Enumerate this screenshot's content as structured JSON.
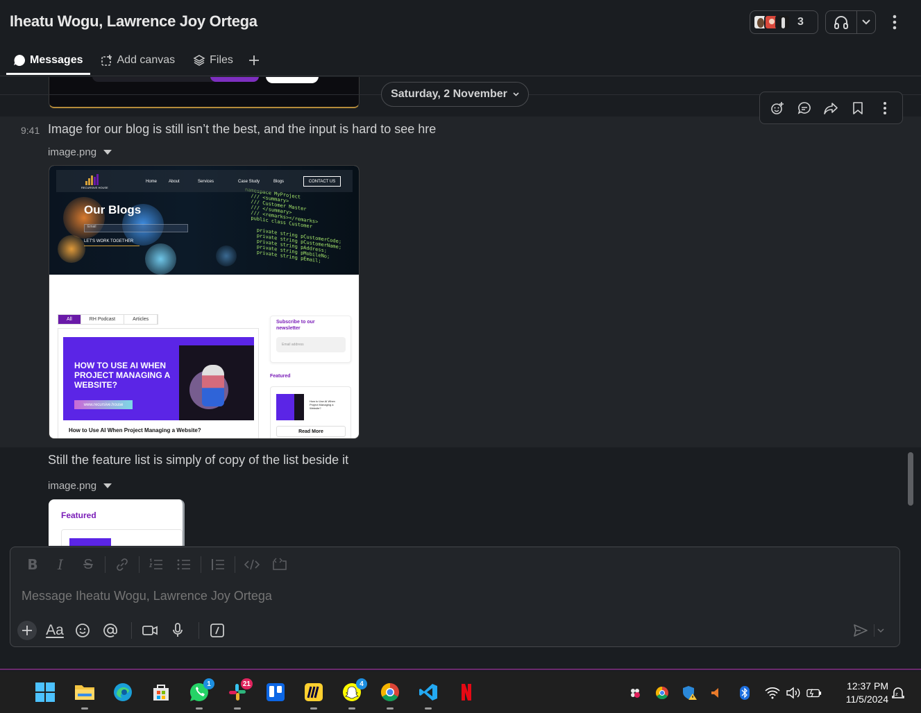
{
  "header": {
    "title": "Iheatu Wogu, Lawrence Joy Ortega",
    "member_count": "3",
    "avatars": [
      "avatar-1",
      "avatar-2",
      "avatar-3"
    ]
  },
  "tabs": [
    {
      "label": "Messages",
      "icon": "message-bubble-icon",
      "active": true
    },
    {
      "label": "Add canvas",
      "icon": "canvas-icon"
    },
    {
      "label": "Files",
      "icon": "layers-icon"
    }
  ],
  "date_divider": "Saturday, 2 November",
  "messages": [
    {
      "time": "9:41",
      "text": "Image for our blog is still isn’t the best, and the input is hard to see hre",
      "attachment": "image.png"
    },
    {
      "text": "Still the feature list is simply of copy of the list beside it",
      "attachment": "image.png"
    }
  ],
  "shot1": {
    "nav_items": [
      "Home",
      "About",
      "Services",
      "Case Study",
      "Blogs"
    ],
    "contact": "CONTACT US",
    "logo_text": "RECURSIVE HOUSE",
    "hero_title": "Our Blogs",
    "hero_input": "Email",
    "hero_cta": "LET'S WORK TOGETHER",
    "tabs": [
      "All",
      "RH Podcast",
      "Articles"
    ],
    "banner_title": "HOW TO USE AI WHEN PROJECT MANAGING A WEBSITE?",
    "banner_url": "www.recursive.house",
    "card_title": "How to Use AI When Project Managing a Website?",
    "subscribe": "Subscribe to our newsletter",
    "email_placeholder": "Email address",
    "featured": "Featured",
    "featured_text": "How to Use AI When Project Managing a Website?",
    "read_more": "Read More",
    "code_lines": "namespace MyProject\n  /// <summary>\n  /// Customer Master\n  /// </summary>\n  /// <remarks></remarks>\n  public class Customer\n\n    private string pCustomerCode;\n    private string pCustomerName;\n    private string pAddress;\n    private string pMobileNo;\n    private string pEmail;"
  },
  "shot2": {
    "featured": "Featured"
  },
  "composer": {
    "placeholder": "Message Iheatu Wogu, Lawrence Joy Ortega"
  },
  "taskbar": {
    "time": "12:37 PM",
    "date": "11/5/2024",
    "badges": {
      "whatsapp": "1",
      "slack": "21",
      "snapchat": "4"
    }
  },
  "colors": {
    "background": "#1a1d21",
    "accent_purple": "#7a1db8",
    "slack_window_border": "#6b2a6e"
  }
}
